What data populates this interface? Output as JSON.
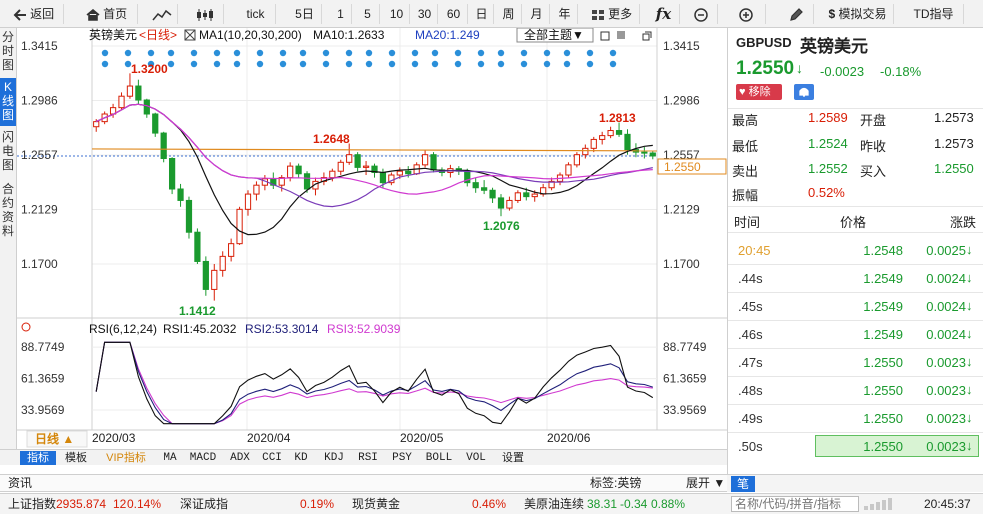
{
  "toolbar": {
    "back": "返回",
    "home": "首页",
    "tick": "tick",
    "d5": "5日",
    "m1": "1",
    "m5": "5",
    "m10": "10",
    "m30": "30",
    "m60": "60",
    "day": "日",
    "week": "周",
    "month": "月",
    "year": "年",
    "more": "更多",
    "fx": "fx",
    "sim_trade": "模拟交易",
    "td": "TD指导"
  },
  "left_tabs": [
    "分时图",
    "K线图",
    "闪电图",
    "合约资料"
  ],
  "chart": {
    "instrument": "英镑美元",
    "period_label": "<日线>",
    "ma_legend": {
      "label": "MA1(10,20,30,200)",
      "ma10": "MA10:1.2633",
      "ma20": "MA20:1.249"
    },
    "theme_button": "全部主题▼",
    "price_axis": [
      "1.3415",
      "1.2986",
      "1.2557",
      "1.2129",
      "1.1700"
    ],
    "rsi_axis": [
      "88.7749",
      "61.3659",
      "33.9569"
    ],
    "price_tag": "1.2550",
    "annotations": {
      "high_mar": "1.3200",
      "low_mar": "1.1412",
      "apr_high": "1.2648",
      "may_low": "1.2076",
      "jun_high": "1.2813"
    },
    "rsi_legend": {
      "label": "RSI(6,12,24)",
      "rsi1": "RSI1:45.2032",
      "rsi2": "RSI2:53.3014",
      "rsi3": "RSI3:52.9039"
    },
    "period_button": "日线 ▲",
    "x_labels": [
      "2020/03",
      "2020/04",
      "2020/05",
      "2020/06"
    ],
    "colors": {
      "up": "#d81e06",
      "down": "#1a9a2e",
      "ma10": "#111111",
      "ma20": "#7a3cb8",
      "ma30": "#d03ad0",
      "ma200": "#e08a1e",
      "rsi1": "#111111",
      "rsi2": "#20207a",
      "rsi3": "#d03ad0"
    }
  },
  "indicator_bar": {
    "items": [
      "指标",
      "模板",
      "VIP指标",
      "MA",
      "MACD",
      "ADX",
      "CCI",
      "KD",
      "KDJ",
      "RSI",
      "PSY",
      "BOLL",
      "VOL",
      "设置"
    ]
  },
  "info_bar": {
    "info": "资讯",
    "tag": "标签:英镑",
    "expand": "展开 ▼",
    "selected": "笔"
  },
  "status_bar": {
    "sh_label": "上证指数",
    "sh_value": "2935.874",
    "sh_chg": "12",
    "sh_pct": "0.14%",
    "sz_label": "深证成指",
    "sz_pct": "0.19%",
    "gold_label": "现货黄金",
    "gold_pct": "0.46%",
    "oil_label": "美原油连续",
    "oil_value": "38.31",
    "oil_chg": "-0.34",
    "oil_pct": "0.88%",
    "search_placeholder": "名称/代码/拼音/指标",
    "time": "20:45:37"
  },
  "quote": {
    "code": "GBPUSD",
    "name": "英镑美元",
    "last": "1.2550",
    "change": "-0.0023",
    "pct": "-0.18%",
    "remove_btn": "移除",
    "high_label": "最高",
    "high": "1.2589",
    "open_label": "开盘",
    "open": "1.2573",
    "low_label": "最低",
    "low": "1.2524",
    "prev_label": "昨收",
    "prev": "1.2573",
    "sell_label": "卖出",
    "sell": "1.2552",
    "buy_label": "买入",
    "buy": "1.2550",
    "amp_label": "振幅",
    "amp": "0.52%",
    "ticks_header": {
      "time": "时间",
      "price": "价格",
      "change": "涨跌"
    },
    "ticks": [
      {
        "time": "20:45",
        "price": "1.2548",
        "change": "0.0025"
      },
      {
        "time": ".44s",
        "price": "1.2549",
        "change": "0.0024"
      },
      {
        "time": ".45s",
        "price": "1.2549",
        "change": "0.0024"
      },
      {
        "time": ".46s",
        "price": "1.2549",
        "change": "0.0024"
      },
      {
        "time": ".47s",
        "price": "1.2550",
        "change": "0.0023"
      },
      {
        "time": ".48s",
        "price": "1.2550",
        "change": "0.0023"
      },
      {
        "time": ".49s",
        "price": "1.2550",
        "change": "0.0023"
      },
      {
        "time": ".50s",
        "price": "1.2550",
        "change": "0.0023"
      }
    ]
  },
  "chart_data": {
    "type": "candlestick",
    "title": "英镑美元 <日线>",
    "x_labels": [
      "2020/03",
      "2020/04",
      "2020/05",
      "2020/06"
    ],
    "ylim": [
      1.1412,
      1.3415
    ],
    "candles": [
      [
        1.278,
        1.284,
        1.274,
        1.282
      ],
      [
        1.282,
        1.29,
        1.28,
        1.288
      ],
      [
        1.288,
        1.296,
        1.285,
        1.293
      ],
      [
        1.293,
        1.305,
        1.291,
        1.302
      ],
      [
        1.302,
        1.32,
        1.3,
        1.31
      ],
      [
        1.31,
        1.315,
        1.296,
        1.299
      ],
      [
        1.299,
        1.3,
        1.285,
        1.288
      ],
      [
        1.288,
        1.289,
        1.27,
        1.273
      ],
      [
        1.273,
        1.274,
        1.25,
        1.253
      ],
      [
        1.253,
        1.254,
        1.225,
        1.229
      ],
      [
        1.229,
        1.233,
        1.215,
        1.22
      ],
      [
        1.22,
        1.223,
        1.19,
        1.195
      ],
      [
        1.195,
        1.198,
        1.17,
        1.172
      ],
      [
        1.172,
        1.176,
        1.145,
        1.15
      ],
      [
        1.15,
        1.17,
        1.1412,
        1.165
      ],
      [
        1.165,
        1.18,
        1.16,
        1.176
      ],
      [
        1.176,
        1.19,
        1.172,
        1.186
      ],
      [
        1.186,
        1.215,
        1.185,
        1.213
      ],
      [
        1.213,
        1.228,
        1.208,
        1.225
      ],
      [
        1.225,
        1.235,
        1.22,
        1.232
      ],
      [
        1.232,
        1.24,
        1.228,
        1.237
      ],
      [
        1.237,
        1.242,
        1.229,
        1.232
      ],
      [
        1.232,
        1.24,
        1.227,
        1.238
      ],
      [
        1.238,
        1.25,
        1.235,
        1.247
      ],
      [
        1.247,
        1.249,
        1.238,
        1.241
      ],
      [
        1.241,
        1.243,
        1.226,
        1.229
      ],
      [
        1.229,
        1.238,
        1.224,
        1.235
      ],
      [
        1.235,
        1.242,
        1.232,
        1.238
      ],
      [
        1.238,
        1.245,
        1.235,
        1.243
      ],
      [
        1.243,
        1.252,
        1.24,
        1.25
      ],
      [
        1.25,
        1.2648,
        1.248,
        1.256
      ],
      [
        1.256,
        1.258,
        1.243,
        1.246
      ],
      [
        1.246,
        1.251,
        1.24,
        1.247
      ],
      [
        1.247,
        1.249,
        1.238,
        1.242
      ],
      [
        1.242,
        1.245,
        1.23,
        1.234
      ],
      [
        1.234,
        1.242,
        1.232,
        1.24
      ],
      [
        1.24,
        1.246,
        1.237,
        1.243
      ],
      [
        1.243,
        1.247,
        1.238,
        1.241
      ],
      [
        1.241,
        1.25,
        1.24,
        1.248
      ],
      [
        1.248,
        1.26,
        1.246,
        1.256
      ],
      [
        1.256,
        1.258,
        1.242,
        1.244
      ],
      [
        1.244,
        1.246,
        1.239,
        1.242
      ],
      [
        1.242,
        1.248,
        1.238,
        1.245
      ],
      [
        1.245,
        1.247,
        1.24,
        1.243
      ],
      [
        1.243,
        1.245,
        1.231,
        1.234
      ],
      [
        1.234,
        1.238,
        1.226,
        1.23
      ],
      [
        1.23,
        1.236,
        1.225,
        1.228
      ],
      [
        1.228,
        1.23,
        1.218,
        1.222
      ],
      [
        1.222,
        1.225,
        1.2076,
        1.214
      ],
      [
        1.214,
        1.223,
        1.212,
        1.22
      ],
      [
        1.22,
        1.228,
        1.218,
        1.226
      ],
      [
        1.226,
        1.23,
        1.22,
        1.223
      ],
      [
        1.223,
        1.228,
        1.219,
        1.225
      ],
      [
        1.225,
        1.233,
        1.223,
        1.23
      ],
      [
        1.23,
        1.238,
        1.228,
        1.235
      ],
      [
        1.235,
        1.242,
        1.232,
        1.24
      ],
      [
        1.24,
        1.25,
        1.238,
        1.248
      ],
      [
        1.248,
        1.258,
        1.246,
        1.256
      ],
      [
        1.256,
        1.264,
        1.253,
        1.261
      ],
      [
        1.261,
        1.27,
        1.258,
        1.268
      ],
      [
        1.268,
        1.274,
        1.264,
        1.271
      ],
      [
        1.271,
        1.278,
        1.269,
        1.275
      ],
      [
        1.275,
        1.2813,
        1.27,
        1.272
      ],
      [
        1.272,
        1.276,
        1.256,
        1.26
      ],
      [
        1.26,
        1.265,
        1.254,
        1.258
      ],
      [
        1.258,
        1.262,
        1.253,
        1.2573
      ],
      [
        1.2573,
        1.2589,
        1.2524,
        1.255
      ]
    ],
    "ma10": "MA10:1.2633",
    "ma20": "MA20:1.249",
    "rsi": {
      "rsi1": "RSI1:45.2032",
      "rsi2": "RSI2:53.3014",
      "rsi3": "RSI3:52.9039",
      "ylim": [
        20,
        95
      ]
    }
  }
}
